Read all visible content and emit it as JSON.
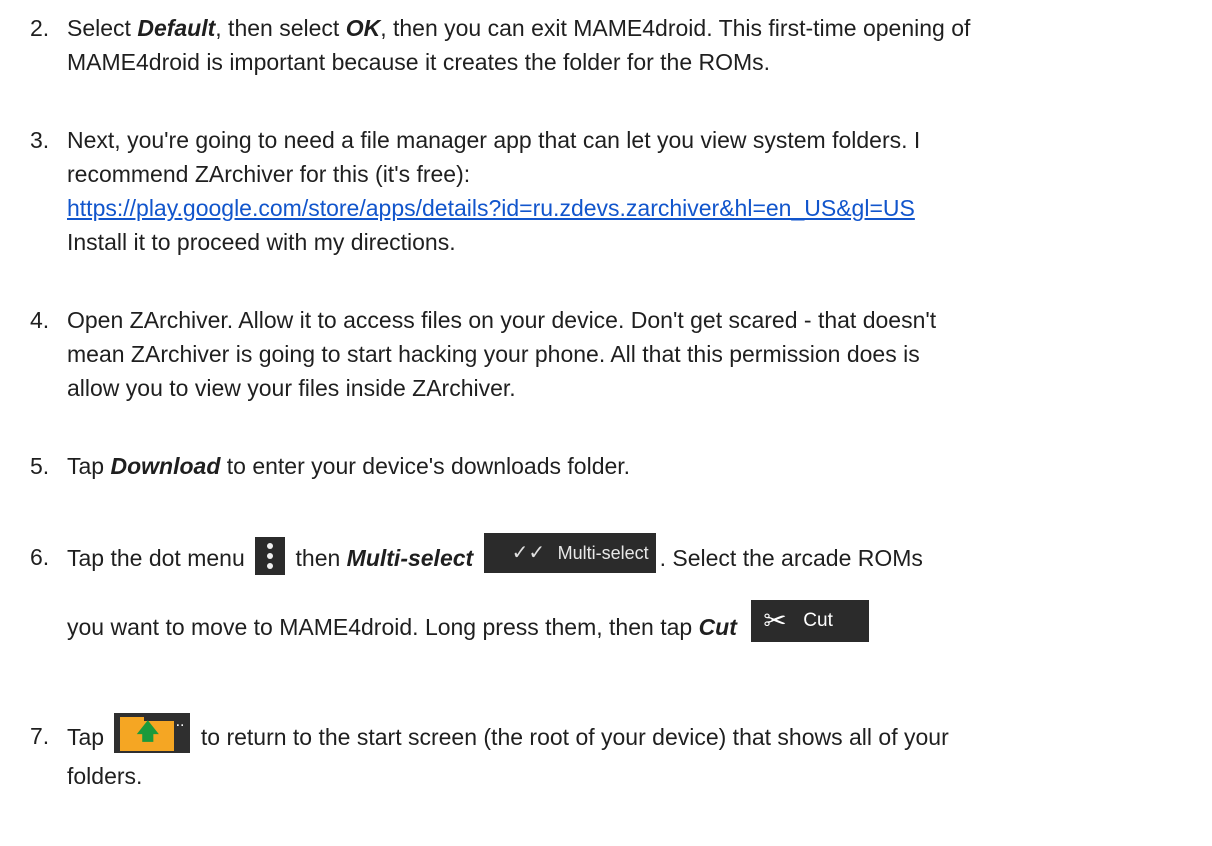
{
  "steps": [
    {
      "number": "2.",
      "line1_a": "Select ",
      "line1_b": "Default",
      "line1_c": ", then select ",
      "line1_d": "OK",
      "line1_e": ", then you can exit MAME4droid. This first-time opening of",
      "line2": "MAME4droid is important because it creates the folder for the ROMs."
    },
    {
      "number": "3.",
      "line1": "Next, you're going to need a file manager app that can let you view system folders. I",
      "line2": "recommend ZArchiver for this (it's free):",
      "link": "https://play.google.com/store/apps/details?id=ru.zdevs.zarchiver&hl=en_US&gl=US",
      "line4": "Install it to proceed with my directions."
    },
    {
      "number": "4.",
      "line1": "Open ZArchiver. Allow it to access files on your device. Don't get scared - that doesn't",
      "line2": "mean ZArchiver is going to start hacking your phone. All that this permission does is",
      "line3": "allow you to view your files inside ZArchiver."
    },
    {
      "number": "5.",
      "a": "Tap ",
      "b": "Download",
      "c": " to enter your device's downloads folder."
    },
    {
      "number": "6.",
      "a": "Tap the dot menu",
      "b": "then ",
      "c": "Multi-select",
      "multi_button_label": "Multi-select",
      "d": ". Select the arcade ROMs",
      "e": "you want to move to MAME4droid. Long press them, then tap ",
      "f": "Cut",
      "cut_button_label": "Cut"
    },
    {
      "number": "7.",
      "a": "Tap",
      "b": "to return to the start screen (the root of your device) that shows all of your",
      "c": "folders."
    }
  ],
  "icons": {
    "multi_select": "double-check-icon",
    "cut": "scissors-icon",
    "folder_up": "folder-up-icon",
    "dot_menu": "vertical-dots-icon"
  },
  "colors": {
    "text": "#1f1f1f",
    "link": "#1155cc",
    "button_bg": "#2b2b2b",
    "folder": "#f5a623",
    "arrow": "#1b9a3b"
  }
}
